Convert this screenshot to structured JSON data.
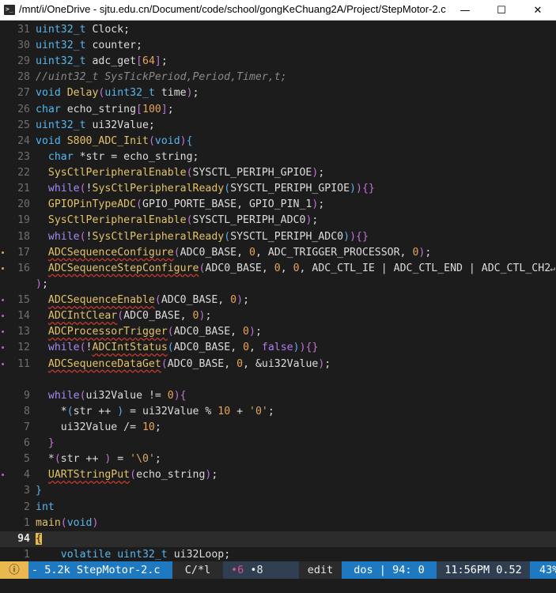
{
  "window": {
    "title": "/mnt/i/OneDrive - sjtu.edu.cn/Document/code/school/gongKeChuang2A/Project/StepMotor-2.c",
    "minimize": "—",
    "maximize": "☐",
    "close": "✕"
  },
  "editor": {
    "wrap_marker": "↵"
  },
  "lines": [
    {
      "num": "31",
      "dot": "",
      "tokens": [
        [
          "t-type",
          "uint32_t"
        ],
        [
          "t-id",
          " Clock;"
        ]
      ]
    },
    {
      "num": "30",
      "dot": "",
      "tokens": [
        [
          "t-type",
          "uint32_t"
        ],
        [
          "t-id",
          " counter;"
        ]
      ]
    },
    {
      "num": "29",
      "dot": "",
      "tokens": [
        [
          "t-type",
          "uint32_t"
        ],
        [
          "t-id",
          " adc_get"
        ],
        [
          "t-brk",
          "["
        ],
        [
          "t-num",
          "64"
        ],
        [
          "t-brk",
          "]"
        ],
        [
          "t-id",
          ";"
        ]
      ]
    },
    {
      "num": "28",
      "dot": "",
      "tokens": [
        [
          "t-cm",
          "//uint32_t SysTickPeriod,Period,Timer,t;"
        ]
      ]
    },
    {
      "num": "27",
      "dot": "",
      "tokens": [
        [
          "t-type",
          "void"
        ],
        [
          "t-id",
          " "
        ],
        [
          "t-func",
          "Delay"
        ],
        [
          "t-brk",
          "("
        ],
        [
          "t-type",
          "uint32_t"
        ],
        [
          "t-id",
          " time"
        ],
        [
          "t-brk",
          ")"
        ],
        [
          "t-id",
          ";"
        ]
      ]
    },
    {
      "num": "26",
      "dot": "",
      "tokens": [
        [
          "t-type",
          "char"
        ],
        [
          "t-id",
          " echo_string"
        ],
        [
          "t-brk",
          "["
        ],
        [
          "t-num",
          "100"
        ],
        [
          "t-brk",
          "]"
        ],
        [
          "t-id",
          ";"
        ]
      ]
    },
    {
      "num": "25",
      "dot": "",
      "tokens": [
        [
          "t-type",
          "uint32_t"
        ],
        [
          "t-id",
          " ui32Value;"
        ]
      ]
    },
    {
      "num": "24",
      "dot": "",
      "tokens": [
        [
          "t-type",
          "void"
        ],
        [
          "t-id",
          " "
        ],
        [
          "t-func",
          "S800_ADC_Init"
        ],
        [
          "t-brk",
          "("
        ],
        [
          "t-type",
          "void"
        ],
        [
          "t-brk",
          ")"
        ],
        [
          "t-br2",
          "{"
        ]
      ]
    },
    {
      "num": "23",
      "dot": "",
      "tokens": [
        [
          "t-id",
          "  "
        ],
        [
          "t-type",
          "char"
        ],
        [
          "t-id",
          " *str = echo_string;"
        ]
      ]
    },
    {
      "num": "22",
      "dot": "",
      "tokens": [
        [
          "t-id",
          "  "
        ],
        [
          "t-func",
          "SysCtlPeripheralEnable"
        ],
        [
          "t-brk",
          "("
        ],
        [
          "t-id",
          "SYSCTL_PERIPH_GPIOE"
        ],
        [
          "t-brk",
          ")"
        ],
        [
          "t-id",
          ";"
        ]
      ]
    },
    {
      "num": "21",
      "dot": "",
      "tokens": [
        [
          "t-id",
          "  "
        ],
        [
          "t-kw",
          "while"
        ],
        [
          "t-brk",
          "("
        ],
        [
          "t-id",
          "!"
        ],
        [
          "t-func",
          "SysCtlPeripheralReady"
        ],
        [
          "t-br2",
          "("
        ],
        [
          "t-id",
          "SYSCTL_PERIPH_GPIOE"
        ],
        [
          "t-br2",
          ")"
        ],
        [
          "t-brk",
          ")"
        ],
        [
          "t-brk",
          "{}"
        ]
      ]
    },
    {
      "num": "20",
      "dot": "",
      "tokens": [
        [
          "t-id",
          "  "
        ],
        [
          "t-func",
          "GPIOPinTypeADC"
        ],
        [
          "t-brk",
          "("
        ],
        [
          "t-id",
          "GPIO_PORTE_BASE, GPIO_PIN_1"
        ],
        [
          "t-brk",
          ")"
        ],
        [
          "t-id",
          ";"
        ]
      ]
    },
    {
      "num": "19",
      "dot": "",
      "tokens": [
        [
          "t-id",
          "  "
        ],
        [
          "t-func",
          "SysCtlPeripheralEnable"
        ],
        [
          "t-brk",
          "("
        ],
        [
          "t-id",
          "SYSCTL_PERIPH_ADC0"
        ],
        [
          "t-brk",
          ")"
        ],
        [
          "t-id",
          ";"
        ]
      ]
    },
    {
      "num": "18",
      "dot": "",
      "tokens": [
        [
          "t-id",
          "  "
        ],
        [
          "t-kw",
          "while"
        ],
        [
          "t-brk",
          "("
        ],
        [
          "t-id",
          "!"
        ],
        [
          "t-func",
          "SysCtlPeripheralReady"
        ],
        [
          "t-br2",
          "("
        ],
        [
          "t-id",
          "SYSCTL_PERIPH_ADC0"
        ],
        [
          "t-br2",
          ")"
        ],
        [
          "t-brk",
          ")"
        ],
        [
          "t-brk",
          "{}"
        ]
      ]
    },
    {
      "num": "17",
      "dot": "y",
      "tokens": [
        [
          "t-id",
          "  "
        ],
        [
          "t-func t-warn",
          "ADCSequenceConfigure"
        ],
        [
          "t-brk",
          "("
        ],
        [
          "t-id",
          "ADC0_BASE, "
        ],
        [
          "t-num",
          "0"
        ],
        [
          "t-id",
          ", ADC_TRIGGER_PROCESSOR, "
        ],
        [
          "t-num",
          "0"
        ],
        [
          "t-brk",
          ")"
        ],
        [
          "t-id",
          ";"
        ]
      ]
    },
    {
      "num": "16",
      "dot": "y",
      "wrap": true,
      "tokens": [
        [
          "t-id",
          "  "
        ],
        [
          "t-func t-warn",
          "ADCSequenceStepConfigure"
        ],
        [
          "t-brk",
          "("
        ],
        [
          "t-id",
          "ADC0_BASE, "
        ],
        [
          "t-num",
          "0"
        ],
        [
          "t-id",
          ", "
        ],
        [
          "t-num",
          "0"
        ],
        [
          "t-id",
          ", ADC_CTL_IE | ADC_CTL_END | ADC_CTL_CH2"
        ]
      ]
    },
    {
      "num": "",
      "dot": "",
      "tokens": [
        [
          "t-brk",
          ")"
        ],
        [
          "t-id",
          ";"
        ]
      ]
    },
    {
      "num": "15",
      "dot": "p",
      "tokens": [
        [
          "t-id",
          "  "
        ],
        [
          "t-func t-warn",
          "ADCSequenceEnable"
        ],
        [
          "t-brk",
          "("
        ],
        [
          "t-id",
          "ADC0_BASE, "
        ],
        [
          "t-num",
          "0"
        ],
        [
          "t-brk",
          ")"
        ],
        [
          "t-id",
          ";"
        ]
      ]
    },
    {
      "num": "14",
      "dot": "p",
      "tokens": [
        [
          "t-id",
          "  "
        ],
        [
          "t-func t-warn",
          "ADCIntClear"
        ],
        [
          "t-brk",
          "("
        ],
        [
          "t-id",
          "ADC0_BASE, "
        ],
        [
          "t-num",
          "0"
        ],
        [
          "t-brk",
          ")"
        ],
        [
          "t-id",
          ";"
        ]
      ]
    },
    {
      "num": "13",
      "dot": "p",
      "tokens": [
        [
          "t-id",
          "  "
        ],
        [
          "t-func t-warn",
          "ADCProcessorTrigger"
        ],
        [
          "t-brk",
          "("
        ],
        [
          "t-id",
          "ADC0_BASE, "
        ],
        [
          "t-num",
          "0"
        ],
        [
          "t-brk",
          ")"
        ],
        [
          "t-id",
          ";"
        ]
      ]
    },
    {
      "num": "12",
      "dot": "p",
      "tokens": [
        [
          "t-id",
          "  "
        ],
        [
          "t-kw",
          "while"
        ],
        [
          "t-brk",
          "("
        ],
        [
          "t-id",
          "!"
        ],
        [
          "t-func t-warn",
          "ADCIntStatus"
        ],
        [
          "t-br2",
          "("
        ],
        [
          "t-id",
          "ADC0_BASE, "
        ],
        [
          "t-num",
          "0"
        ],
        [
          "t-id",
          ", "
        ],
        [
          "t-lit",
          "false"
        ],
        [
          "t-br2",
          ")"
        ],
        [
          "t-brk",
          ")"
        ],
        [
          "t-brk",
          "{}"
        ]
      ]
    },
    {
      "num": "11",
      "dot": "p",
      "tokens": [
        [
          "t-id",
          "  "
        ],
        [
          "t-func t-warn",
          "ADCSequenceDataGet"
        ],
        [
          "t-brk",
          "("
        ],
        [
          "t-id",
          "ADC0_BASE, "
        ],
        [
          "t-num",
          "0"
        ],
        [
          "t-id",
          ", &ui32Value"
        ],
        [
          "t-brk",
          ")"
        ],
        [
          "t-id",
          ";"
        ]
      ]
    },
    {
      "num": "",
      "dot": "",
      "tokens": []
    },
    {
      "num": "9",
      "dot": "",
      "tokens": [
        [
          "t-id",
          "  "
        ],
        [
          "t-kw",
          "while"
        ],
        [
          "t-brk",
          "("
        ],
        [
          "t-id",
          "ui32Value != "
        ],
        [
          "t-num",
          "0"
        ],
        [
          "t-brk",
          ")"
        ],
        [
          "t-brk",
          "{"
        ]
      ]
    },
    {
      "num": "8",
      "dot": "",
      "tokens": [
        [
          "t-id",
          "    *"
        ],
        [
          "t-br2",
          "("
        ],
        [
          "t-id",
          "str ++ "
        ],
        [
          "t-br2",
          ")"
        ],
        [
          "t-id",
          " = ui32Value % "
        ],
        [
          "t-num",
          "10"
        ],
        [
          "t-id",
          " + "
        ],
        [
          "t-str",
          "'0'"
        ],
        [
          "t-id",
          ";"
        ]
      ]
    },
    {
      "num": "7",
      "dot": "",
      "tokens": [
        [
          "t-id",
          "    ui32Value /= "
        ],
        [
          "t-num",
          "10"
        ],
        [
          "t-id",
          ";"
        ]
      ]
    },
    {
      "num": "6",
      "dot": "",
      "tokens": [
        [
          "t-id",
          "  "
        ],
        [
          "t-brk",
          "}"
        ]
      ]
    },
    {
      "num": "5",
      "dot": "",
      "tokens": [
        [
          "t-id",
          "  *"
        ],
        [
          "t-brk",
          "("
        ],
        [
          "t-id",
          "str ++ "
        ],
        [
          "t-brk",
          ")"
        ],
        [
          "t-id",
          " = "
        ],
        [
          "t-str",
          "'\\0'"
        ],
        [
          "t-id",
          ";"
        ]
      ]
    },
    {
      "num": "4",
      "dot": "p",
      "tokens": [
        [
          "t-id",
          "  "
        ],
        [
          "t-func t-warn",
          "UARTStringPut"
        ],
        [
          "t-brk",
          "("
        ],
        [
          "t-id",
          "echo_string"
        ],
        [
          "t-brk",
          ")"
        ],
        [
          "t-id",
          ";"
        ]
      ]
    },
    {
      "num": "3",
      "dot": "",
      "tokens": [
        [
          "t-br2",
          "}"
        ]
      ]
    },
    {
      "num": "2",
      "dot": "",
      "tokens": [
        [
          "t-type",
          "int"
        ]
      ]
    },
    {
      "num": "1",
      "dot": "",
      "tokens": [
        [
          "t-func",
          "main"
        ],
        [
          "t-brk",
          "("
        ],
        [
          "t-type",
          "void"
        ],
        [
          "t-brk",
          ")"
        ]
      ]
    },
    {
      "num": "94",
      "dot": "",
      "current": true,
      "tokens": [
        [
          "cursor",
          "{"
        ]
      ]
    },
    {
      "num": "1",
      "dot": "",
      "tokens": [
        [
          "t-id",
          "    "
        ],
        [
          "t-type",
          "volatile uint32_t"
        ],
        [
          "t-id",
          " ui32Loop;"
        ]
      ]
    }
  ],
  "statusbar": {
    "mode_icon": "ⓘ",
    "file": " - 5.2k StepMotor-2.c",
    "lang": "C/*l",
    "diag_errors": "•6",
    "diag_warnings": "•8",
    "state": "edit",
    "position": "dos | 94: 0",
    "time": "11:56PM 0.52",
    "extra": "43%"
  },
  "colors": {
    "background": "#1c1c1c",
    "statusbar_blue": "#1f79c0",
    "statusbar_dark": "#2f3e50",
    "mode_yellow": "#e9b84e"
  }
}
